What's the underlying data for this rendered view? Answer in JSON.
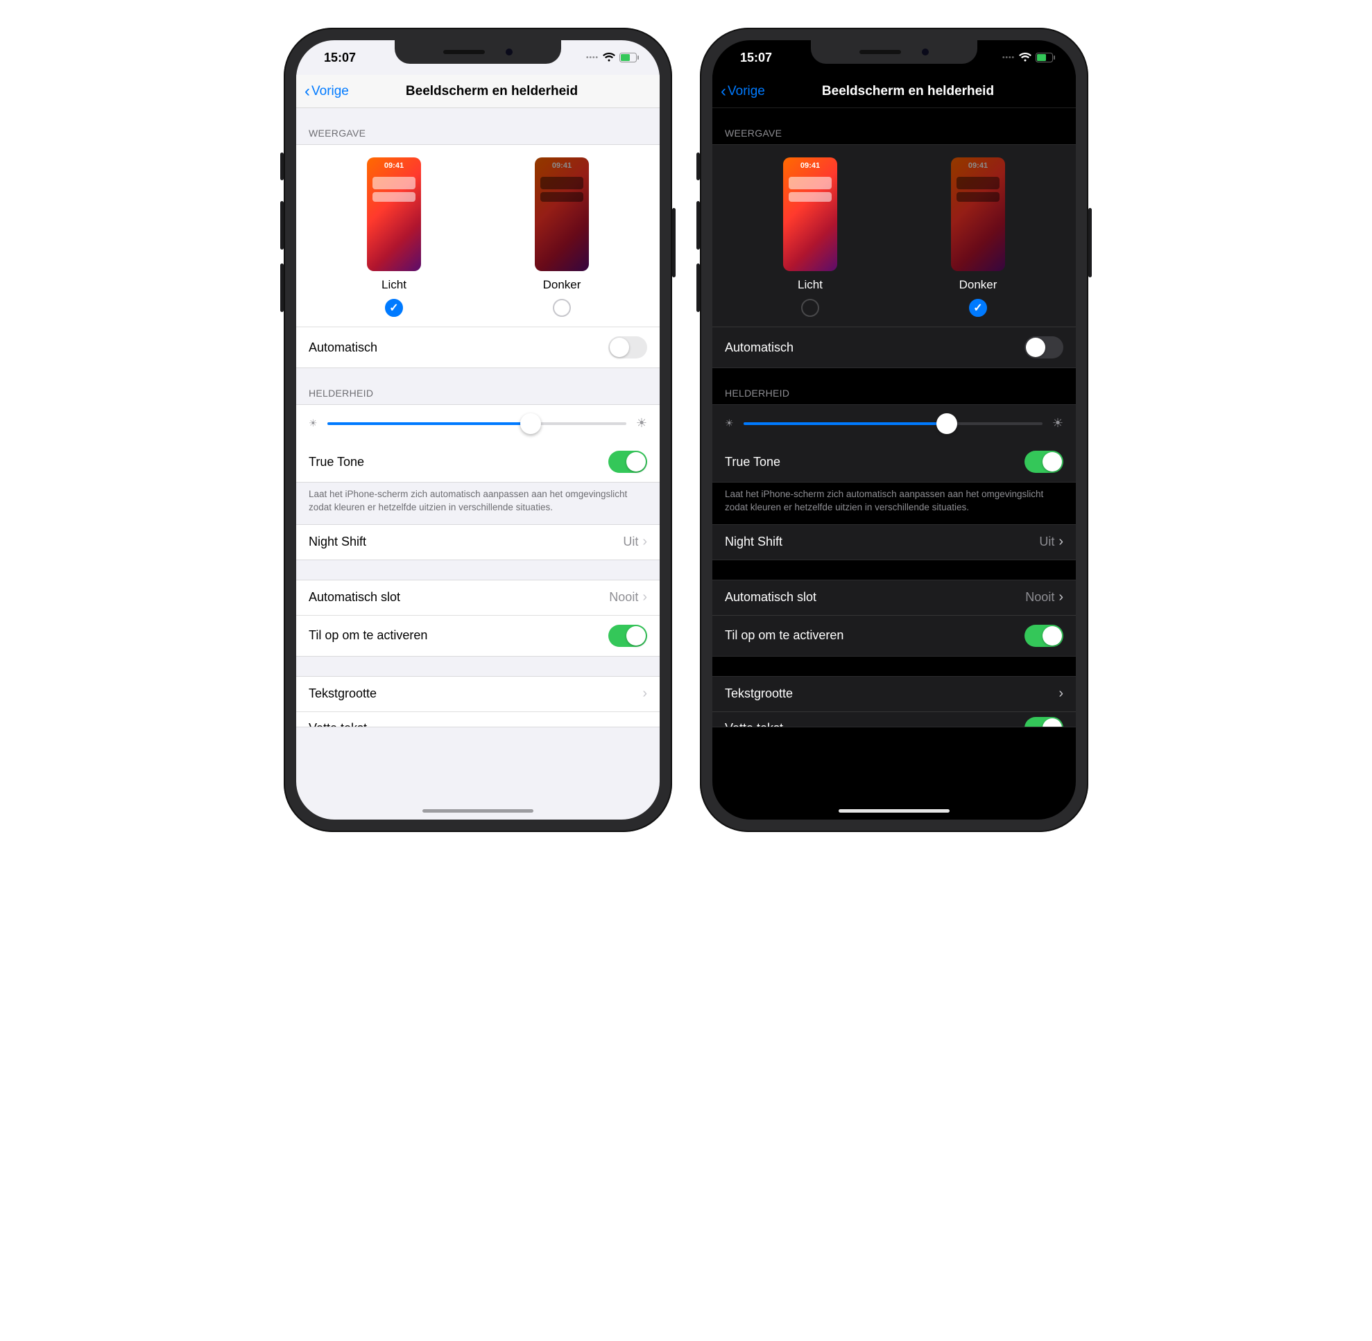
{
  "status": {
    "time": "15:07"
  },
  "nav": {
    "back": "Vorige",
    "title": "Beeldscherm en helderheid"
  },
  "sections": {
    "appearance_header": "WEERGAVE",
    "brightness_header": "HELDERHEID"
  },
  "appearance": {
    "preview_time": "09:41",
    "light_label": "Licht",
    "dark_label": "Donker",
    "automatic_label": "Automatisch",
    "automatic_on": false,
    "light_phone_selected": "light",
    "dark_phone_selected": "dark"
  },
  "brightness": {
    "slider_percent": 68,
    "truetone_label": "True Tone",
    "truetone_on": true,
    "truetone_note": "Laat het iPhone-scherm zich automatisch aanpassen aan het omgevingslicht zodat kleuren er hetzelfde uitzien in verschillende situaties."
  },
  "nightshift": {
    "label": "Night Shift",
    "value": "Uit"
  },
  "autolock": {
    "label": "Automatisch slot",
    "value": "Nooit"
  },
  "raise": {
    "label": "Til op om te activeren",
    "on": true
  },
  "textsize": {
    "label": "Tekstgrootte"
  },
  "boldtext": {
    "label_partial": "Vette tekst"
  }
}
